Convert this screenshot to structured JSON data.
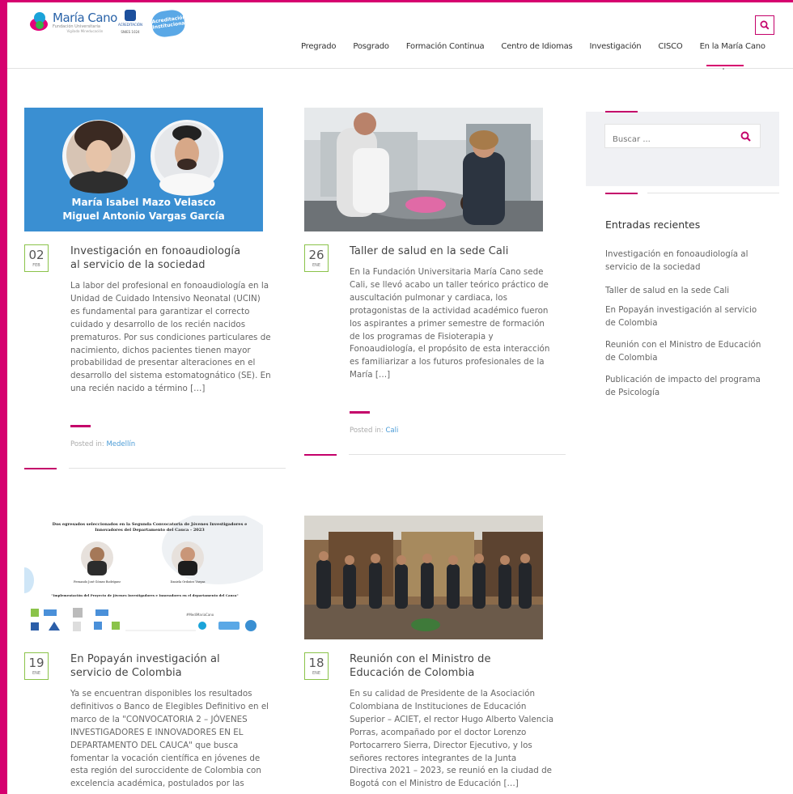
{
  "brand": {
    "name": "María Cano",
    "subtitle": "Fundación Universitaria",
    "tagline": "Vigilada Mineducación",
    "accreditation": "ACREDITACIÓN",
    "accreditation_sub": "SNIES 1024",
    "badge": "Acreditación Institucional"
  },
  "nav": {
    "items": [
      "Pregrado",
      "Posgrado",
      "Formación Continua",
      "Centro de Idiomas",
      "Investigación",
      "CISCO",
      "En la María Cano"
    ]
  },
  "posts": [
    {
      "day": "02",
      "month": "FEB",
      "title_line1": "Investigación en fonoaudiología",
      "title_line2": "al servicio de la sociedad",
      "image_names": [
        "María Isabel Mazo Velasco",
        "Miguel Antonio Vargas García"
      ],
      "excerpt_lines": [
        "La labor del profesional en fonoaudiología en la",
        "Unidad de Cuidado Intensivo Neonatal (UCIN)",
        "es fundamental para garantizar el correcto",
        "cuidado y desarrollo de los recién nacidos",
        "prematuros. Por sus condiciones particulares de",
        "nacimiento, dichos pacientes tienen mayor",
        "probabilidad de presentar alteraciones en el",
        "desarrollo del sistema estomatognático (SE). En",
        "una recién nacido a término […]"
      ],
      "posted_label": "Posted in: ",
      "category": "Medellín"
    },
    {
      "day": "26",
      "month": "ENE",
      "title_line1": "Taller de salud en la sede Cali",
      "title_line2": "",
      "excerpt_lines": [
        "En la Fundación Universitaria María Cano sede",
        "Cali, se llevó acabo un taller teórico práctico de",
        "auscultación pulmonar y cardiaca, los",
        "protagonistas de la actividad académico fueron",
        "los aspirantes a primer semestre de formación",
        "de los programas de Fisioterapia y",
        "Fonoaudiología, el propósito de esta interacción",
        "es familiarizar a los futuros profesionales de la",
        "María […]"
      ],
      "posted_label": "Posted in: ",
      "category": "Cali"
    },
    {
      "day": "19",
      "month": "ENE",
      "title_line1": "En Popayán investigación al",
      "title_line2": "servicio de Colombia",
      "image_heading": "Dos egresados seleccionados en la Segunda Convocatoria de Jóvenes Investigadores e Innovadores del Departamento del Cauca - 2023",
      "image_caption": "\"Implementación del Proyecto de Jóvenes Investigadores e Innovadores en el departamento del Cauca\"",
      "image_hashtag": "#MediMariaCano",
      "image_person1": "Fernando José Gómez Rodríguez",
      "image_person2": "Daniela Ordoñez Vargas",
      "excerpt_lines": [
        "Ya se encuentran disponibles los resultados",
        "definitivos o Banco de Elegibles Definitivo en el",
        "marco de la \"CONVOCATORIA 2 – JÓVENES",
        "INVESTIGADORES E INNOVADORES EN EL",
        "DEPARTAMENTO DEL CAUCA\" que busca",
        "fomentar la vocación científica en jóvenes de",
        "esta región del suroccidente de Colombia con",
        "excelencia académica, postulados por las"
      ]
    },
    {
      "day": "18",
      "month": "ENE",
      "title_line1": "Reunión con el Ministro de",
      "title_line2": "Educación de Colombia",
      "excerpt_lines": [
        "En su calidad de Presidente de la Asociación",
        "Colombiana de Instituciones de Educación",
        "Superior – ACIET, el rector Hugo Alberto Valencia",
        "Porras, acompañado por el doctor Lorenzo",
        "Portocarrero Sierra, Director Ejecutivo, y los",
        "señores rectores integrantes de la Junta",
        "Directiva 2021 – 2023, se reunió en la ciudad de",
        "Bogotá con el Ministro de Educación […]"
      ]
    }
  ],
  "sidebar": {
    "search_placeholder": "Buscar ...",
    "recent_title": "Entradas recientes",
    "recent": [
      [
        "Investigación en fonoaudiología al",
        "servicio de la sociedad"
      ],
      [
        "Taller de salud en la sede Cali"
      ],
      [
        "En Popayán investigación al servicio",
        "de Colombia"
      ],
      [
        "Reunión con el Ministro de Educación",
        "de Colombia"
      ],
      [
        "Publicación de impacto del programa",
        "de Psicología"
      ]
    ]
  },
  "colors": {
    "accent": "#c4006a",
    "frame": "#d6006f",
    "date_border": "#8bc34a",
    "link": "#4a9bd6"
  }
}
